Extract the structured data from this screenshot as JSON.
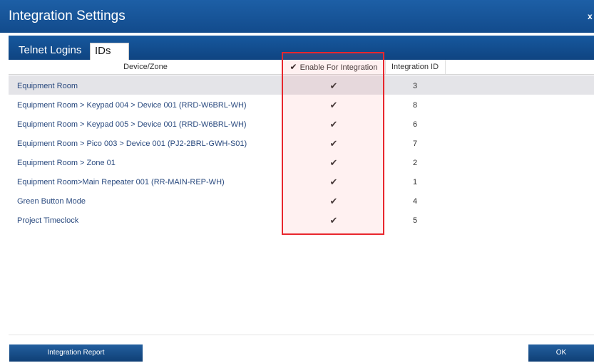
{
  "window": {
    "title": "Integration Settings",
    "close_glyph": "x"
  },
  "tabs": [
    {
      "label": "Telnet Logins",
      "active": false
    },
    {
      "label": "IDs",
      "active": true
    }
  ],
  "table": {
    "columns": {
      "device": "Device/Zone",
      "enable": "Enable For Integration",
      "id": "Integration ID"
    },
    "rows": [
      {
        "device": "Equipment Room",
        "enabled": true,
        "id": "3",
        "selected": true
      },
      {
        "device": "Equipment Room > Keypad 004 > Device 001 (RRD-W6BRL-WH)",
        "enabled": true,
        "id": "8"
      },
      {
        "device": "Equipment Room > Keypad 005 > Device 001 (RRD-W6BRL-WH)",
        "enabled": true,
        "id": "6"
      },
      {
        "device": "Equipment Room > Pico 003 > Device 001 (PJ2-2BRL-GWH-S01)",
        "enabled": true,
        "id": "7"
      },
      {
        "device": "Equipment Room > Zone 01",
        "enabled": true,
        "id": "2"
      },
      {
        "device": "Equipment Room>Main Repeater 001 (RR-MAIN-REP-WH)",
        "enabled": true,
        "id": "1"
      },
      {
        "device": "Green Button Mode",
        "enabled": true,
        "id": "4"
      },
      {
        "device": "Project Timeclock",
        "enabled": true,
        "id": "5"
      }
    ]
  },
  "buttons": {
    "report": "Integration Report",
    "ok": "OK"
  },
  "colors": {
    "titlebar": "#1d5fa6",
    "highlight": "#e8262d",
    "link_text": "#2a4a7f"
  },
  "icons": {
    "check": "checkmark-icon",
    "close": "close-icon"
  }
}
